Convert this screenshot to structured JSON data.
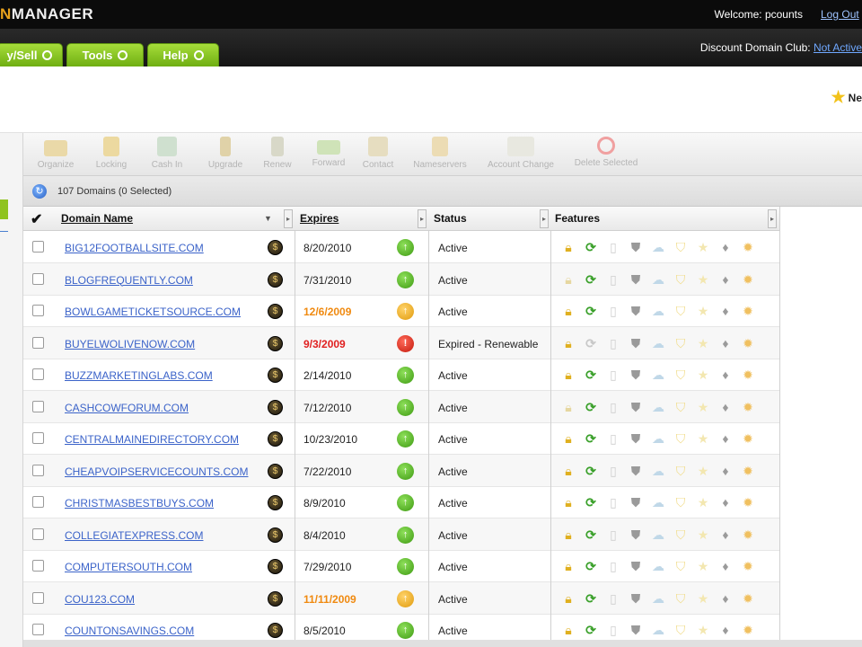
{
  "app": {
    "logo_prefix": "N",
    "logo_main": "MANAGER"
  },
  "topbar": {
    "welcome": "Welcome: pcounts",
    "logout": "Log Out"
  },
  "nav": {
    "tabs": [
      {
        "label": "y/Sell"
      },
      {
        "label": "Tools"
      },
      {
        "label": "Help"
      }
    ],
    "club_label": "Discount Domain Club:",
    "club_status": "Not Active"
  },
  "header": {
    "new_label": "Ne"
  },
  "toolbar": {
    "items": [
      {
        "label": "Organize",
        "icon": "folder-icon"
      },
      {
        "label": "Locking",
        "icon": "lock-icon"
      },
      {
        "label": "Cash In",
        "icon": "cash-icon"
      },
      {
        "label": "Upgrade",
        "icon": "upgrade-icon"
      },
      {
        "label": "Renew",
        "icon": "renew-icon"
      },
      {
        "label": "Forward",
        "icon": "forward-icon"
      },
      {
        "label": "Contact",
        "icon": "contact-icon"
      },
      {
        "label": "Nameservers",
        "icon": "nameservers-icon"
      },
      {
        "label": "Account Change",
        "icon": "account-change-icon"
      },
      {
        "label": "Delete Selected",
        "icon": "delete-icon"
      }
    ]
  },
  "grid": {
    "count_label": "107 Domains (0 Selected)",
    "columns": {
      "domain": "Domain Name",
      "expires": "Expires",
      "status": "Status",
      "features": "Features"
    },
    "rows": [
      {
        "domain": "BIG12FOOTBALLSITE.COM",
        "expires": "8/20/2010",
        "exp_state": "ok",
        "status_state": "green",
        "status": "Active",
        "lock": "on",
        "renew": "on"
      },
      {
        "domain": "BLOGFREQUENTLY.COM",
        "expires": "7/31/2010",
        "exp_state": "ok",
        "status_state": "green",
        "status": "Active",
        "lock": "off",
        "renew": "on"
      },
      {
        "domain": "BOWLGAMETICKETSOURCE.COM",
        "expires": "12/6/2009",
        "exp_state": "soon",
        "status_state": "orange",
        "status": "Active",
        "lock": "on",
        "renew": "on"
      },
      {
        "domain": "BUYELWOLIVENOW.COM",
        "expires": "9/3/2009",
        "exp_state": "late",
        "status_state": "red",
        "status": "Expired - Renewable",
        "lock": "on",
        "renew": "off"
      },
      {
        "domain": "BUZZMARKETINGLABS.COM",
        "expires": "2/14/2010",
        "exp_state": "ok",
        "status_state": "green",
        "status": "Active",
        "lock": "on",
        "renew": "on"
      },
      {
        "domain": "CASHCOWFORUM.COM",
        "expires": "7/12/2010",
        "exp_state": "ok",
        "status_state": "green",
        "status": "Active",
        "lock": "off",
        "renew": "on"
      },
      {
        "domain": "CENTRALMAINEDIRECTORY.COM",
        "expires": "10/23/2010",
        "exp_state": "ok",
        "status_state": "green",
        "status": "Active",
        "lock": "on",
        "renew": "on"
      },
      {
        "domain": "CHEAPVOIPSERVICECOUNTS.COM",
        "expires": "7/22/2010",
        "exp_state": "ok",
        "status_state": "green",
        "status": "Active",
        "lock": "on",
        "renew": "on"
      },
      {
        "domain": "CHRISTMASBESTBUYS.COM",
        "expires": "8/9/2010",
        "exp_state": "ok",
        "status_state": "green",
        "status": "Active",
        "lock": "on",
        "renew": "on"
      },
      {
        "domain": "COLLEGIATEXPRESS.COM",
        "expires": "8/4/2010",
        "exp_state": "ok",
        "status_state": "green",
        "status": "Active",
        "lock": "on",
        "renew": "on"
      },
      {
        "domain": "COMPUTERSOUTH.COM",
        "expires": "7/29/2010",
        "exp_state": "ok",
        "status_state": "green",
        "status": "Active",
        "lock": "on",
        "renew": "on"
      },
      {
        "domain": "COU123.COM",
        "expires": "11/11/2009",
        "exp_state": "soon",
        "status_state": "orange",
        "status": "Active",
        "lock": "on",
        "renew": "on"
      },
      {
        "domain": "COUNTONSAVINGS.COM",
        "expires": "8/5/2010",
        "exp_state": "ok",
        "status_state": "green",
        "status": "Active",
        "lock": "on",
        "renew": "on"
      }
    ]
  },
  "colors": {
    "nav_green": "#8fc31f",
    "link_blue": "#3b63c9",
    "expire_soon": "#f08a10",
    "expired": "#e02020"
  }
}
